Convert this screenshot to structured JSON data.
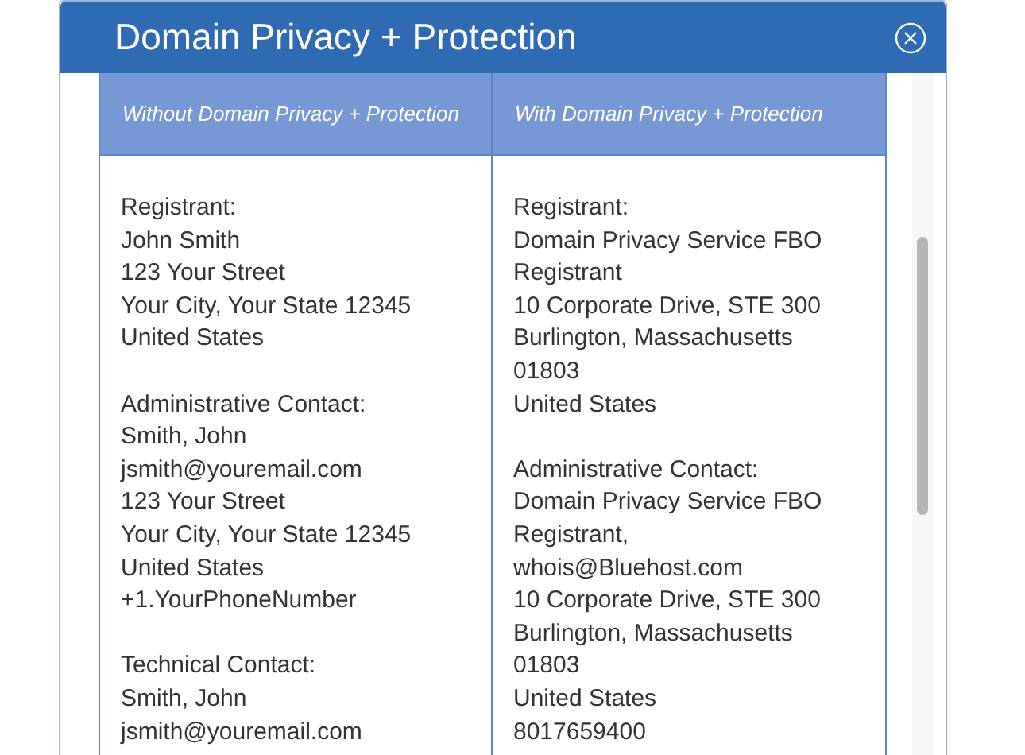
{
  "dialog": {
    "title": "Domain Privacy + Protection"
  },
  "table": {
    "columns": [
      "Without Domain Privacy + Protection",
      "With Domain Privacy + Protection"
    ],
    "cells": [
      [
        [
          "Registrant:",
          "John Smith",
          "123 Your Street",
          "Your City, Your State 12345",
          "United States"
        ],
        [
          "Administrative Contact:",
          "Smith, John",
          "jsmith@youremail.com",
          "123 Your Street",
          "Your City, Your State 12345",
          "United States",
          "+1.YourPhoneNumber"
        ],
        [
          "Technical Contact:",
          "Smith, John",
          "jsmith@youremail.com"
        ]
      ],
      [
        [
          "Registrant:",
          "Domain Privacy Service FBO",
          "Registrant",
          "10 Corporate Drive, STE 300",
          "Burlington, Massachusetts",
          "01803",
          "United States"
        ],
        [
          "Administrative Contact:",
          "Domain Privacy Service FBO",
          "Registrant,",
          "whois@Bluehost.com",
          "10 Corporate Drive, STE 300",
          "Burlington, Massachusetts",
          "01803",
          "United States",
          "8017659400"
        ]
      ]
    ]
  }
}
